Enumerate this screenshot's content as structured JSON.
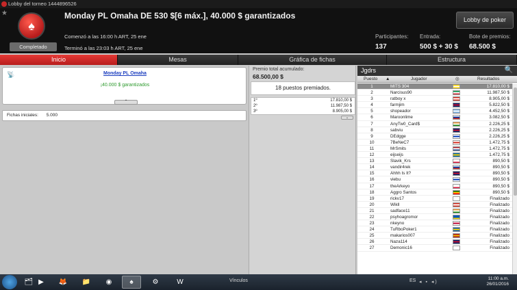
{
  "window": {
    "title": "Lobby del torneo 1444896526"
  },
  "header": {
    "tournament_title": "Monday PL Omaha DE 530 $[6 máx.], 40.000 $ garantizados",
    "status": "Completado",
    "started": "Comenzó a las 16:00 h ART, 25 ene",
    "ended": "Terminó a las 23:03 h ART, 25 ene",
    "stats": [
      {
        "label": "Participantes:",
        "value": "137"
      },
      {
        "label": "Entrada:",
        "value": "500 $ + 30 $"
      },
      {
        "label": "Bote de premios:",
        "value": "68.500 $"
      }
    ],
    "lobby_button": "Lobby de poker"
  },
  "tabs": [
    {
      "label": "Inicio",
      "active": true
    },
    {
      "label": "Mesas",
      "active": false
    },
    {
      "label": "Gráfica de fichas",
      "active": false
    },
    {
      "label": "Estructura",
      "active": false
    }
  ],
  "info": {
    "name": "Monday PL Omaha",
    "prize": "¡40.000 $ garantizados",
    "chips_label": "Fichas iniciales:",
    "chips_value": "5.000"
  },
  "prize_pool": {
    "label": "Premio total acumulado:",
    "value": "68.500,00 $",
    "paid_text": "18 puestos premiados.",
    "payouts": [
      {
        "place": "1º",
        "amount": "17.810,00 $"
      },
      {
        "place": "2º",
        "amount": "11.987,50 $"
      },
      {
        "place": "3º",
        "amount": "8.905,00 $"
      }
    ]
  },
  "players": {
    "title": "Jgdrs",
    "columns": {
      "pos": "Puesto",
      "player": "Jugador",
      "results": "Resultados"
    },
    "rows": [
      {
        "pos": "1",
        "name": "MITS 304",
        "result": "17.810,00 $",
        "flag": [
          "#ffd400",
          "#ffffff",
          "#ffd400"
        ]
      },
      {
        "pos": "2",
        "name": "Narcisus90",
        "result": "11.987,50 $",
        "flag": [
          "#009246",
          "#ffffff",
          "#ce2b37"
        ]
      },
      {
        "pos": "3",
        "name": "ratboy x",
        "result": "8.905,00 $",
        "flag": [
          "#d52b1e",
          "#ffffff",
          "#d52b1e"
        ]
      },
      {
        "pos": "4",
        "name": "farmjim",
        "result": "5.822,50 $",
        "flag": [
          "#012169",
          "#c8102e",
          "#012169"
        ]
      },
      {
        "pos": "5",
        "name": "shopeador",
        "result": "4.452,50 $",
        "flag": [
          "#74acdf",
          "#ffffff",
          "#74acdf"
        ]
      },
      {
        "pos": "6",
        "name": "Maroonlime",
        "result": "3.082,50 $",
        "flag": [
          "#ffffff",
          "#0033a0",
          "#d52b1e"
        ]
      },
      {
        "pos": "7",
        "name": "AnyTw0_Card$",
        "result": "2.226,25 $",
        "flag": [
          "#ff9933",
          "#ffffff",
          "#138808"
        ]
      },
      {
        "pos": "8",
        "name": "sabviu",
        "result": "2.226,25 $",
        "flag": [
          "#012169",
          "#c8102e",
          "#012169"
        ]
      },
      {
        "pos": "9",
        "name": "DEdgge",
        "result": "2.226,25 $",
        "flag": [
          "#ffffff",
          "#0038b8",
          "#ffffff"
        ]
      },
      {
        "pos": "10",
        "name": "7BeNeC7",
        "result": "1.472,75 $",
        "flag": [
          "#ffffff",
          "#d52b1e",
          "#ffffff"
        ]
      },
      {
        "pos": "11",
        "name": "MrSmits",
        "result": "1.472,75 $",
        "flag": [
          "#ae1c28",
          "#ffffff",
          "#21468b"
        ]
      },
      {
        "pos": "12",
        "name": "eijseijs",
        "result": "1.472,75 $",
        "flag": [
          "#006aa7",
          "#fecc00",
          "#006aa7"
        ]
      },
      {
        "pos": "13",
        "name": "Slavik_Krs",
        "result": "890,50 $",
        "flag": [
          "#ffffff",
          "#ffffff",
          "#dc143c"
        ]
      },
      {
        "pos": "14",
        "name": "vandir4rek",
        "result": "890,50 $",
        "flag": [
          "#ffffff",
          "#0039a6",
          "#d52b1e"
        ]
      },
      {
        "pos": "15",
        "name": "Ahhh Is It?",
        "result": "890,50 $",
        "flag": [
          "#012169",
          "#c8102e",
          "#012169"
        ]
      },
      {
        "pos": "16",
        "name": "viebu",
        "result": "890,50 $",
        "flag": [
          "#ffffff",
          "#0038b8",
          "#ffffff"
        ]
      },
      {
        "pos": "17",
        "name": "theArkeyo",
        "result": "890,50 $",
        "flag": [
          "#ffffff",
          "#ffffff",
          "#dc143c"
        ]
      },
      {
        "pos": "18",
        "name": "Aggro Santos",
        "result": "890,50 $",
        "flag": [
          "#006600",
          "#ffcc00",
          "#ff0000"
        ]
      },
      {
        "pos": "19",
        "name": "rickv17",
        "result": "Finalizado",
        "flag": [
          "#ffffff",
          "#ffffff",
          "#ffffff"
        ]
      },
      {
        "pos": "20",
        "name": "Wikll",
        "result": "Finalizado",
        "flag": [
          "#d52b1e",
          "#ffffff",
          "#d52b1e"
        ]
      },
      {
        "pos": "21",
        "name": "sadface11",
        "result": "Finalizado",
        "flag": [
          "#ff9933",
          "#ffffff",
          "#138808"
        ]
      },
      {
        "pos": "22",
        "name": "psyhoagromor",
        "result": "Finalizado",
        "flag": [
          "#0057b7",
          "#0057b7",
          "#ffd700"
        ]
      },
      {
        "pos": "23",
        "name": "nkeyno",
        "result": "Finalizado",
        "flag": [
          "#ffffff",
          "#bc002d",
          "#ffffff"
        ]
      },
      {
        "pos": "24",
        "name": "TuRboPoker1",
        "result": "Finalizado",
        "flag": [
          "#0057b7",
          "#ffd700",
          "#0057b7"
        ]
      },
      {
        "pos": "25",
        "name": "makarios007",
        "result": "Finalizado",
        "flag": [
          "#aa151b",
          "#f1bf00",
          "#aa151b"
        ]
      },
      {
        "pos": "26",
        "name": "Naza114",
        "result": "Finalizado",
        "flag": [
          "#012169",
          "#c8102e",
          "#012169"
        ]
      },
      {
        "pos": "27",
        "name": "Demonic16",
        "result": "Finalizado",
        "flag": [
          "#ffffff",
          "#ffffff",
          "#ffffff"
        ]
      }
    ]
  },
  "taskbar": {
    "links_label": "Vínculos",
    "lang": "ES",
    "time": "11:00 a.m.",
    "date": "26/01/2016"
  },
  "colors": {
    "accent": "#d32f2f",
    "header_bg": "#111111",
    "selected_row": "#8a8a8a"
  }
}
